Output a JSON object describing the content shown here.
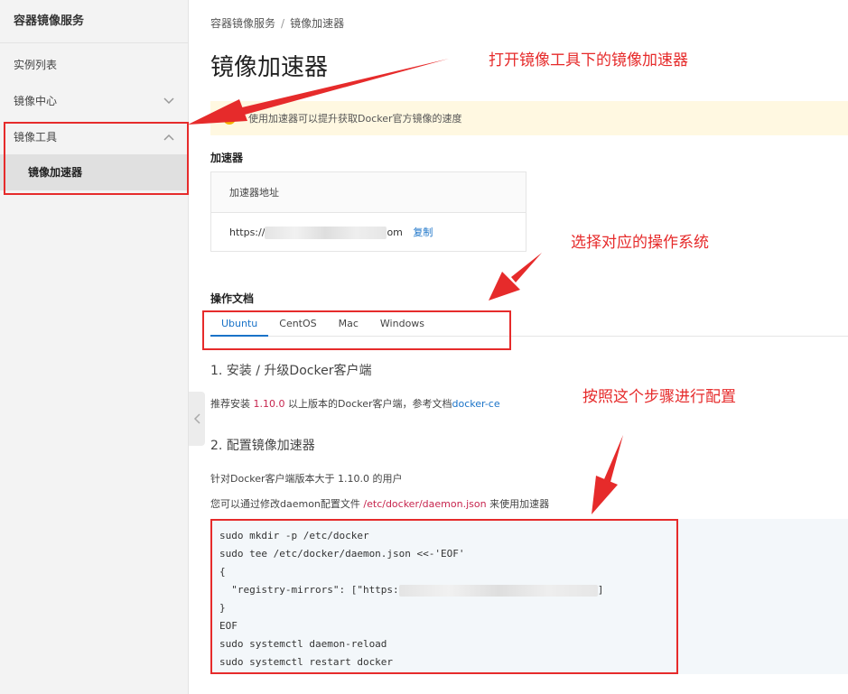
{
  "sidebar": {
    "title": "容器镜像服务",
    "items": [
      {
        "label": "实例列表"
      },
      {
        "label": "镜像中心"
      },
      {
        "label": "镜像工具"
      }
    ],
    "sub_item": "镜像加速器"
  },
  "breadcrumb": {
    "root": "容器镜像服务",
    "separator": "/",
    "current": "镜像加速器"
  },
  "page_title": "镜像加速器",
  "notice": "使用加速器可以提升获取Docker官方镜像的速度",
  "accelerator": {
    "section_label": "加速器",
    "header": "加速器地址",
    "url_prefix": "https://",
    "url_suffix": "om",
    "copy_label": "复制"
  },
  "docs": {
    "section_label": "操作文档",
    "tabs": [
      {
        "label": "Ubuntu",
        "active": true
      },
      {
        "label": "CentOS"
      },
      {
        "label": "Mac"
      },
      {
        "label": "Windows"
      }
    ],
    "step1_title": "1. 安装 / 升级Docker客户端",
    "step1_text_a": "推荐安装 ",
    "step1_version": "1.10.0",
    "step1_text_b": " 以上版本的Docker客户端，参考文档",
    "step1_link": "docker-ce",
    "step2_title": "2. 配置镜像加速器",
    "step2_text1": "针对Docker客户端版本大于 1.10.0 的用户",
    "step2_text2_a": "您可以通过修改daemon配置文件 ",
    "step2_path": "/etc/docker/daemon.json",
    "step2_text2_b": " 来使用加速器"
  },
  "code_lines": [
    "sudo mkdir -p /etc/docker",
    "sudo tee /etc/docker/daemon.json <<-'EOF'",
    "{",
    "  \"registry-mirrors\": [\"https:",
    "}",
    "EOF",
    "sudo systemctl daemon-reload",
    "sudo systemctl restart docker"
  ],
  "code_line4_tail": "]",
  "annotations": {
    "a1": "打开镜像工具下的镜像加速器",
    "a2": "选择对应的操作系统",
    "a3": "按照这个步骤进行配置"
  },
  "colors": {
    "accent": "#1a73c8",
    "annotation": "#e62b2b",
    "warning": "#f5b400"
  }
}
